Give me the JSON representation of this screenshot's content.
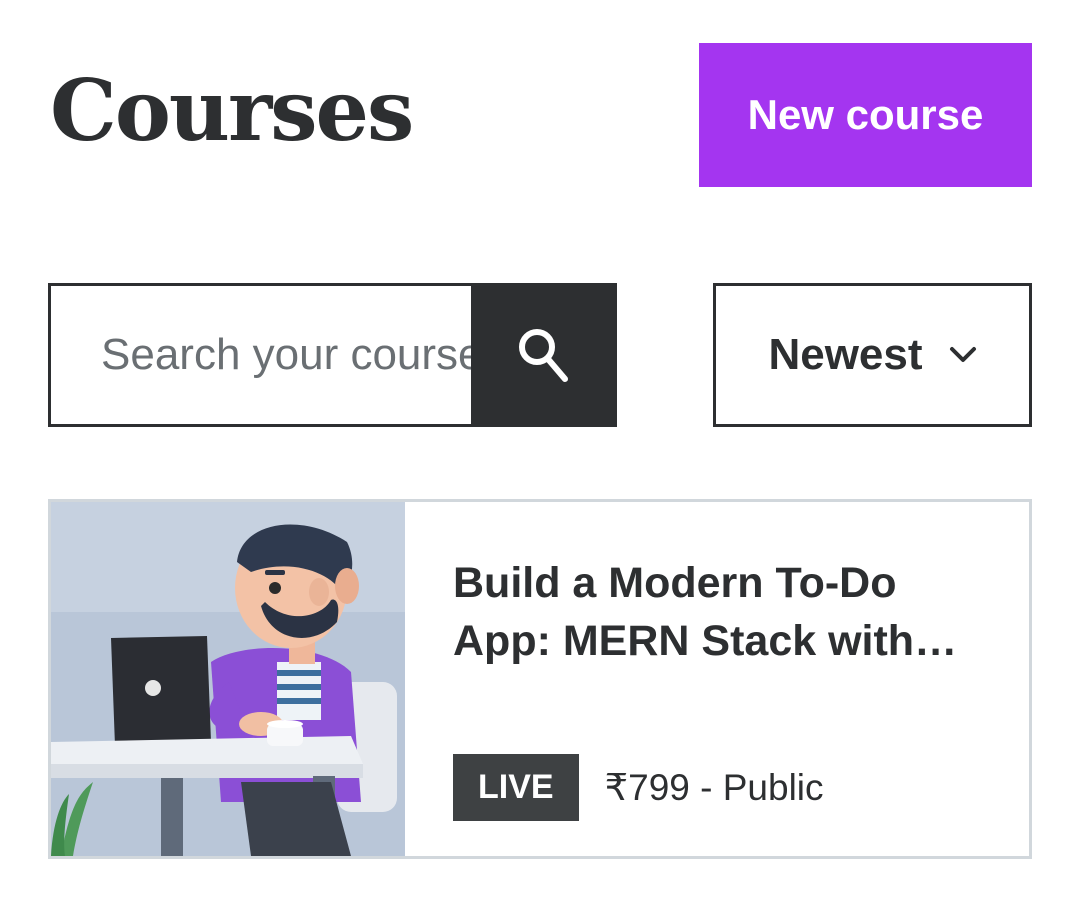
{
  "header": {
    "title": "Courses",
    "new_course_label": "New course"
  },
  "search": {
    "placeholder": "Search your courses",
    "value": "",
    "button_icon": "search-icon"
  },
  "sort": {
    "selected": "Newest",
    "icon": "chevron-down-icon"
  },
  "courses": [
    {
      "title": "Build a Modern To-Do App: MERN Stack with React",
      "status": "LIVE",
      "price_visibility": "₹799 - Public"
    }
  ],
  "colors": {
    "brand": "#a435f0",
    "dark": "#2d2f31",
    "badge": "#3e4143",
    "card_border": "#d1d7dc"
  }
}
